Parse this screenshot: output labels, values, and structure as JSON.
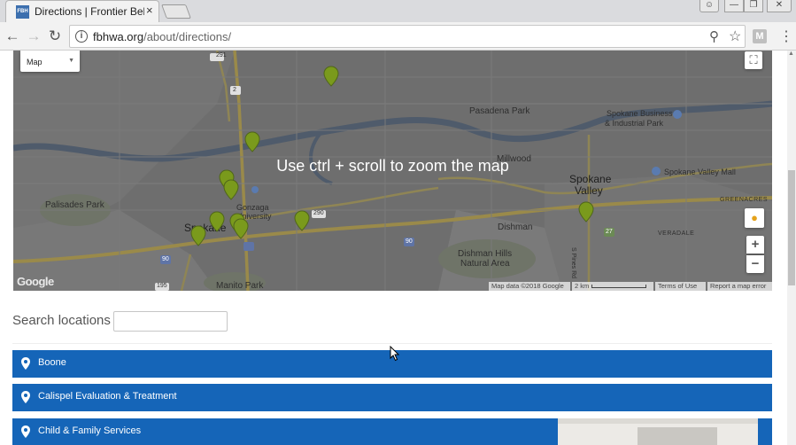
{
  "browser": {
    "tab_title": "Directions | Frontier Behavioral Health",
    "tab_favicon_text": "FBH",
    "tab_close": "×",
    "url_domain": "fbhwa.org",
    "url_path": "/about/directions/",
    "extension_label": "M"
  },
  "map": {
    "type_label": "Map",
    "overlay_text": "Use ctrl + scroll to zoom the map",
    "zoom_in": "+",
    "zoom_out": "−",
    "google_logo": "Google",
    "attribution": "Map data ©2018 Google",
    "scale": "2 km",
    "terms": "Terms of Use",
    "report": "Report a map error",
    "labels": {
      "pasadena_park": "Pasadena Park",
      "spokane_business": "Spokane Business",
      "industrial_park": "& Industrial Park",
      "millwood": "Millwood",
      "spokane_valley": "Spokane",
      "valley": "Valley",
      "spokane_valley_mall": "Spokane Valley Mall",
      "greenacres": "GREENACRES",
      "palisades_park": "Palisades Park",
      "gonzaga": "Gonzaga",
      "university": "University",
      "spokane": "Spokane",
      "dishman": "Dishman",
      "dishman_hills": "Dishman Hills",
      "natural_area": "Natural Area",
      "veradale": "VERADALE",
      "manito_park": "Manito Park",
      "pines_rd": "S Pines Rd",
      "rt291": "291",
      "rt2": "2",
      "rt290": "290",
      "rt90a": "90",
      "rt90b": "90",
      "rt27": "27",
      "rt195": "195"
    }
  },
  "search": {
    "label": "Search locations",
    "value": "",
    "placeholder": ""
  },
  "locations": [
    {
      "label": "Boone"
    },
    {
      "label": "Calispel Evaluation & Treatment"
    },
    {
      "label": "Child & Family Services"
    }
  ],
  "colors": {
    "location_bar": "#1565b8",
    "marker": "#7a9a1c"
  }
}
